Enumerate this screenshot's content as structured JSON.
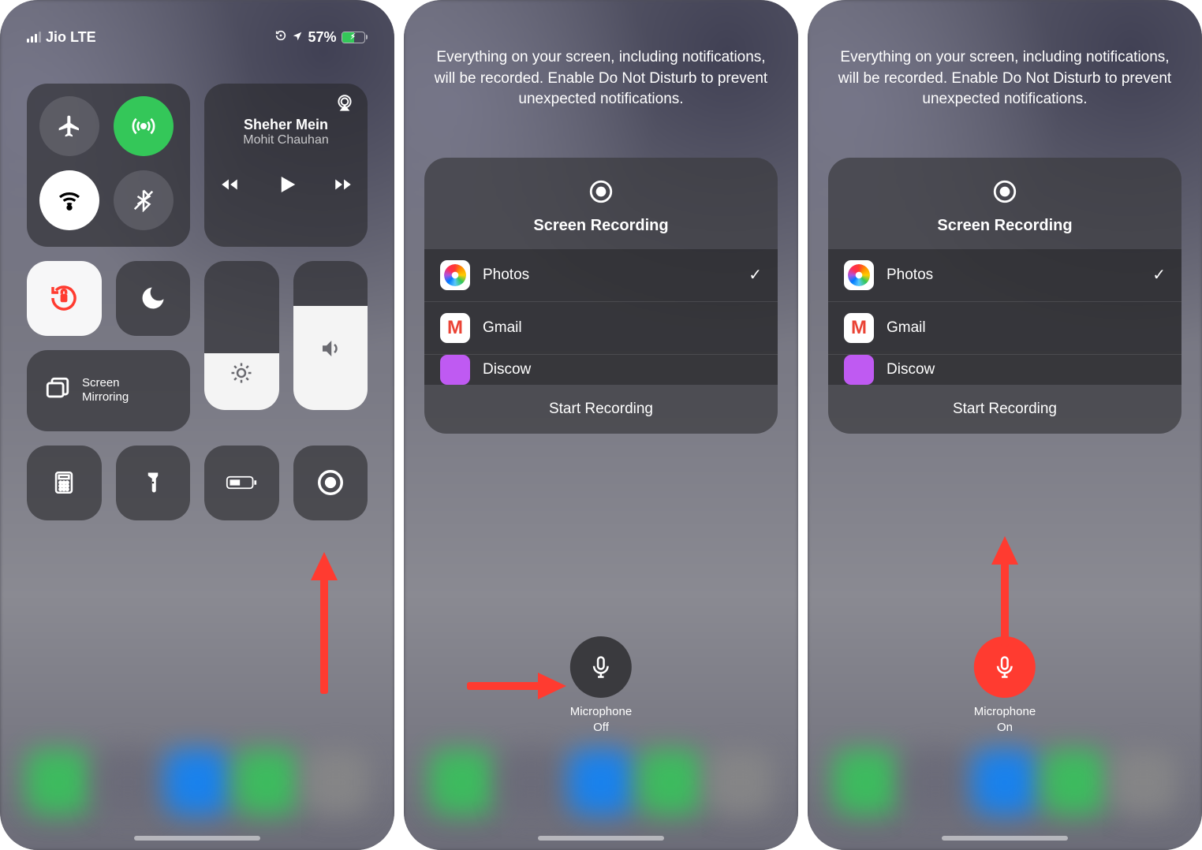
{
  "status": {
    "carrier": "Jio LTE",
    "battery_pct": "57%",
    "rotation_icon": "rotation-lock-icon",
    "location_icon": "location-arrow-icon"
  },
  "media": {
    "title": "Sheher Mein",
    "artist": "Mohit Chauhan"
  },
  "mirror_label": "Screen\nMirroring",
  "recording": {
    "notice": "Everything on your screen, including notifications, will be recorded. Enable Do Not Disturb to prevent unexpected notifications.",
    "title": "Screen Recording",
    "apps": [
      {
        "name": "Photos",
        "selected": true,
        "icon": "photos"
      },
      {
        "name": "Gmail",
        "selected": false,
        "icon": "gmail"
      },
      {
        "name": "Discow",
        "selected": false,
        "icon": "purple",
        "truncated": true
      }
    ],
    "start_label": "Start Recording"
  },
  "mic": {
    "label": "Microphone",
    "off_state": "Off",
    "on_state": "On"
  },
  "colors": {
    "accent_green": "#34c759",
    "accent_red": "#ff3b30",
    "arrow": "#ff3b30"
  },
  "dock_colors": [
    "#34c759",
    "#6a6a78",
    "#0a84ff",
    "#34c759",
    "#888"
  ]
}
